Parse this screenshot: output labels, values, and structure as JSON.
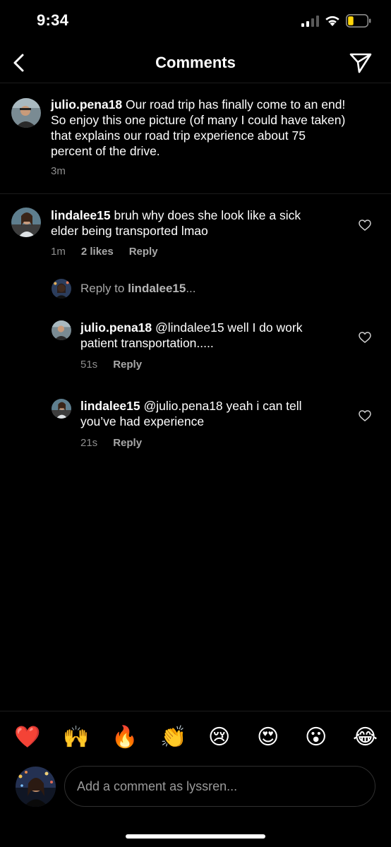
{
  "status_bar": {
    "time": "9:34"
  },
  "header": {
    "title": "Comments"
  },
  "caption": {
    "username": "julio.pena18",
    "lines": [
      "Our road trip has finally come to an end!",
      "So enjoy this one picture (of many I could have taken)",
      "that explains our road trip experience about 75",
      "percent of the drive."
    ],
    "time": "3m"
  },
  "comment": {
    "username": "lindalee15",
    "lines": [
      "bruh why does she look like a sick",
      "elder being transported lmao"
    ],
    "time": "1m",
    "likes": "2 likes",
    "reply_label": "Reply"
  },
  "reply_target": {
    "prefix": "Reply to",
    "username": "lindalee15",
    "suffix": "..."
  },
  "replies": [
    {
      "username": "julio.pena18",
      "lines": [
        "@lindalee15 well I do work",
        "patient transportation....."
      ],
      "time": "51s",
      "reply_label": "Reply"
    },
    {
      "username": "lindalee15",
      "lines": [
        "@julio.pena18 yeah i can tell",
        "you’ve had experience"
      ],
      "time": "21s",
      "reply_label": "Reply"
    }
  ],
  "emoji_bar": [
    "❤️",
    "🙌",
    "🔥",
    "👏",
    "😢",
    "😍",
    "😮",
    "😂"
  ],
  "composer": {
    "placeholder": "Add a comment as lyssren..."
  },
  "colors": {
    "background": "#000000",
    "muted": "#8e8e8e",
    "divider": "#1c1c1c",
    "battery_low": "#ffd60a"
  },
  "icons": [
    "signal-icon",
    "wifi-icon",
    "battery-icon",
    "back-arrow-icon",
    "send-icon",
    "heart-icon"
  ]
}
